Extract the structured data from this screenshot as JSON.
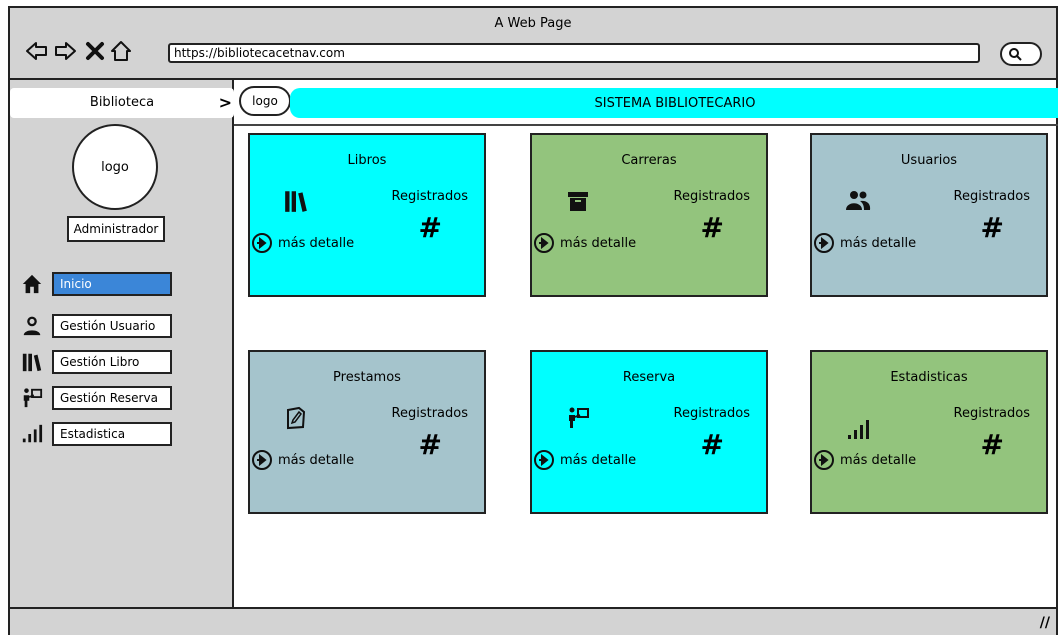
{
  "window": {
    "title": "A Web Page"
  },
  "browser": {
    "url": "https://bibliotecacetnav.com",
    "back_icon": "arrow-left-icon",
    "forward_icon": "arrow-right-icon",
    "close_icon": "close-icon",
    "home_icon": "home-icon",
    "search_icon": "search-icon"
  },
  "sidebar": {
    "header": "Biblioteca",
    "logo": "logo",
    "role": "Administrador",
    "items": [
      {
        "label": "Inicio",
        "icon": "home-icon",
        "active": true
      },
      {
        "label": "Gestión Usuario",
        "icon": "user-icon",
        "active": false
      },
      {
        "label": "Gestión Libro",
        "icon": "books-icon",
        "active": false
      },
      {
        "label": "Gestión Reserva",
        "icon": "reserve-icon",
        "active": false
      },
      {
        "label": "Estadistica",
        "icon": "signal-icon",
        "active": false
      }
    ]
  },
  "topbar": {
    "logo": "logo",
    "title": "SISTEMA BIBLIOTECARIO"
  },
  "cards": [
    {
      "title": "Libros",
      "icon": "books-icon",
      "registered_label": "Registrados",
      "count": "#",
      "more_label": "más detalle",
      "color": "#00ffff"
    },
    {
      "title": "Carreras",
      "icon": "archive-icon",
      "registered_label": "Registrados",
      "count": "#",
      "more_label": "más detalle",
      "color": "#93c47d"
    },
    {
      "title": "Usuarios",
      "icon": "users-icon",
      "registered_label": "Registrados",
      "count": "#",
      "more_label": "más detalle",
      "color": "#a5c4cc"
    },
    {
      "title": "Prestamos",
      "icon": "note-icon",
      "registered_label": "Registrados",
      "count": "#",
      "more_label": "más detalle",
      "color": "#a5c4cc"
    },
    {
      "title": "Reserva",
      "icon": "reserve-icon",
      "registered_label": "Registrados",
      "count": "#",
      "more_label": "más detalle",
      "color": "#00ffff"
    },
    {
      "title": "Estadisticas",
      "icon": "signal-icon",
      "registered_label": "Registrados",
      "count": "#",
      "more_label": "más detalle",
      "color": "#93c47d"
    }
  ]
}
